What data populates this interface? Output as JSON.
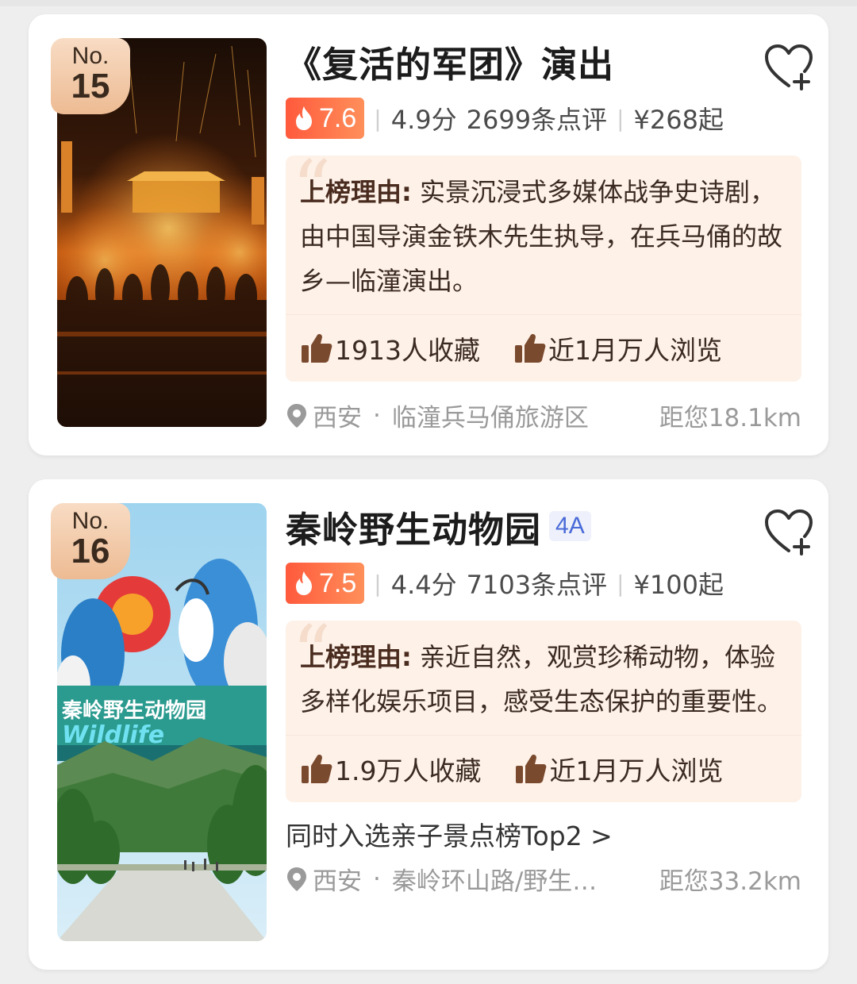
{
  "cards": [
    {
      "rank_prefix": "No.",
      "rank_number": "15",
      "title": "《复活的军团》演出",
      "level": "",
      "hot_score": "7.6",
      "rating": "4.9分",
      "reviews": "2699条点评",
      "price": "¥268起",
      "reason_label": "上榜理由:",
      "reason_text": " 实景沉浸式多媒体战争史诗剧，由中国导演金铁木先生执导，在兵马俑的故乡—临潼演出。",
      "favorites": "1913人收藏",
      "views": "近1月万人浏览",
      "extra": "",
      "city": "西安",
      "area": "临潼兵马俑旅游区",
      "distance": "距您18.1km"
    },
    {
      "rank_prefix": "No.",
      "rank_number": "16",
      "title": "秦岭野生动物园",
      "level": "4A",
      "hot_score": "7.5",
      "rating": "4.4分",
      "reviews": "7103条点评",
      "price": "¥100起",
      "reason_label": "上榜理由:",
      "reason_text": " 亲近自然，观赏珍稀动物，体验多样化娱乐项目，感受生态保护的重要性。",
      "favorites": "1.9万人收藏",
      "views": "近1月万人浏览",
      "extra": "同时入选亲子景点榜Top2 >",
      "city": "西安",
      "area": "秦岭环山路/野生…",
      "distance": "距您33.2km",
      "image_text": "秦岭野生动物园"
    }
  ],
  "colors": {
    "hot_gradient_start": "#ff5a3c",
    "hot_gradient_end": "#ff8f5a",
    "reason_bg": "#fdf1e8",
    "badge_4a": "#4a6ad8"
  },
  "icons": [
    "heart-plus-icon",
    "flame-icon",
    "thumbs-up-icon",
    "location-pin-icon",
    "chevron-right-icon"
  ]
}
